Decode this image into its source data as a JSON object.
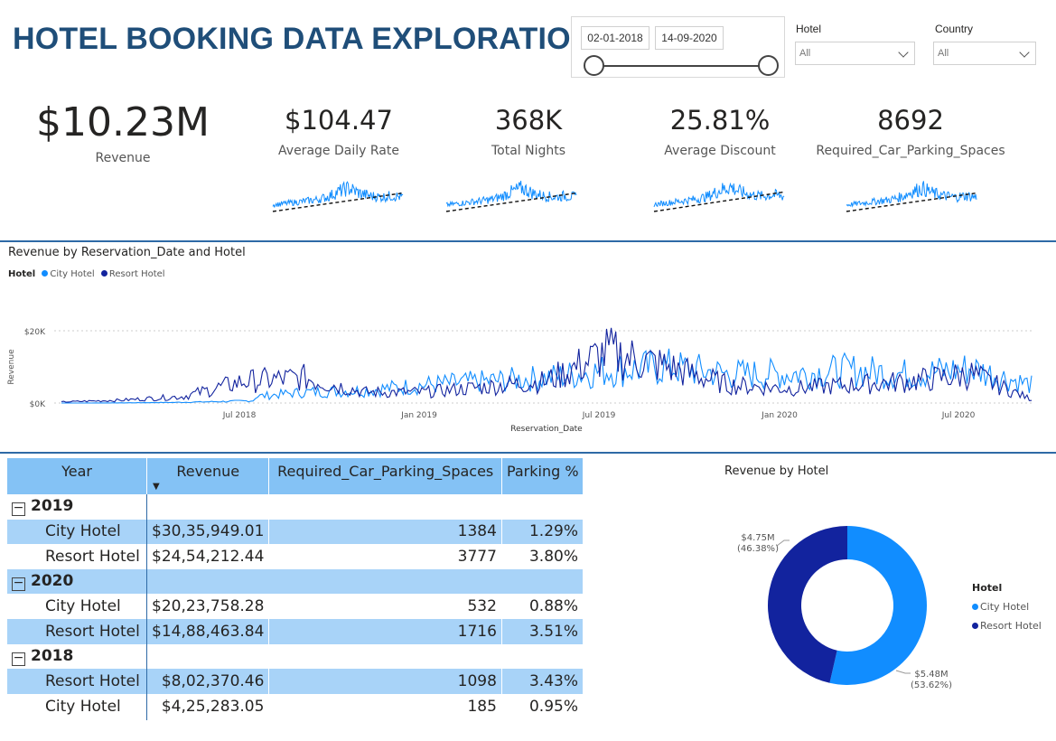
{
  "title": "HOTEL BOOKING DATA EXPLORATION",
  "date_slicer": {
    "start": "02-01-2018",
    "end": "14-09-2020"
  },
  "filters": {
    "hotel": {
      "label": "Hotel",
      "value": "All"
    },
    "country": {
      "label": "Country",
      "value": "All"
    }
  },
  "kpis": {
    "revenue": {
      "value": "$10.23M",
      "label": "Revenue"
    },
    "adr": {
      "value": "$104.47",
      "label": "Average Daily Rate"
    },
    "nights": {
      "value": "368K",
      "label": "Total Nights"
    },
    "discount": {
      "value": "25.81%",
      "label": "Average Discount"
    },
    "parking": {
      "value": "8692",
      "label": "Required_Car_Parking_Spaces"
    }
  },
  "colors": {
    "city": "#118dff",
    "resort": "#12239e",
    "header": "#84c2f5",
    "band": "#a8d3f8",
    "title": "#1f4e79"
  },
  "line_chart": {
    "title": "Revenue by Reservation_Date and Hotel",
    "legend_title": "Hotel",
    "series": [
      "City Hotel",
      "Resort Hotel"
    ],
    "ylabel": "Revenue",
    "xlabel": "Reservation_Date",
    "y_ticks": [
      "$20K",
      "$0K"
    ],
    "x_ticks": [
      "Jul 2018",
      "Jan 2019",
      "Jul 2019",
      "Jan 2020",
      "Jul 2020"
    ]
  },
  "table": {
    "columns": [
      "Year",
      "Revenue",
      "Required_Car_Parking_Spaces",
      "Parking %"
    ],
    "groups": [
      {
        "year": "2019",
        "rows": [
          {
            "hotel": "City Hotel",
            "revenue": "$30,35,949.01",
            "parking": "1384",
            "pct": "1.29%"
          },
          {
            "hotel": "Resort Hotel",
            "revenue": "$24,54,212.44",
            "parking": "3777",
            "pct": "3.80%"
          }
        ]
      },
      {
        "year": "2020",
        "rows": [
          {
            "hotel": "City Hotel",
            "revenue": "$20,23,758.28",
            "parking": "532",
            "pct": "0.88%"
          },
          {
            "hotel": "Resort Hotel",
            "revenue": "$14,88,463.84",
            "parking": "1716",
            "pct": "3.51%"
          }
        ]
      },
      {
        "year": "2018",
        "rows": [
          {
            "hotel": "Resort Hotel",
            "revenue": "$8,02,370.46",
            "parking": "1098",
            "pct": "3.43%"
          },
          {
            "hotel": "City Hotel",
            "revenue": "$4,25,283.05",
            "parking": "185",
            "pct": "0.95%"
          }
        ]
      }
    ]
  },
  "donut": {
    "title": "Revenue by Hotel",
    "legend_title": "Hotel",
    "resort_label_value": "$4.75M",
    "resort_label_pct": "(46.38%)",
    "city_label_value": "$5.48M",
    "city_label_pct": "(53.62%)"
  },
  "chart_data": [
    {
      "type": "line",
      "title": "Revenue by Reservation_Date and Hotel",
      "xlabel": "Reservation_Date",
      "ylabel": "Revenue",
      "x": [
        "2018-01",
        "2018-03",
        "2018-05",
        "2018-07",
        "2018-09",
        "2018-11",
        "2019-01",
        "2019-03",
        "2019-05",
        "2019-07",
        "2019-09",
        "2019-11",
        "2020-01",
        "2020-03",
        "2020-05",
        "2020-07",
        "2020-09"
      ],
      "series": [
        {
          "name": "City Hotel",
          "values": [
            200,
            400,
            800,
            1500,
            3000,
            3500,
            5000,
            6000,
            7000,
            9000,
            10000,
            8000,
            8000,
            9000,
            8000,
            9500,
            5000
          ]
        },
        {
          "name": "Resort Hotel",
          "values": [
            300,
            800,
            1800,
            6000,
            7000,
            3000,
            3000,
            4500,
            6000,
            14000,
            10000,
            5000,
            4000,
            5000,
            6000,
            8000,
            1000
          ]
        }
      ],
      "ylim": [
        0,
        25000
      ]
    },
    {
      "type": "pie",
      "title": "Revenue by Hotel",
      "categories": [
        "City Hotel",
        "Resort Hotel"
      ],
      "values": [
        5.48,
        4.75
      ],
      "percent": [
        53.62,
        46.38
      ]
    }
  ]
}
